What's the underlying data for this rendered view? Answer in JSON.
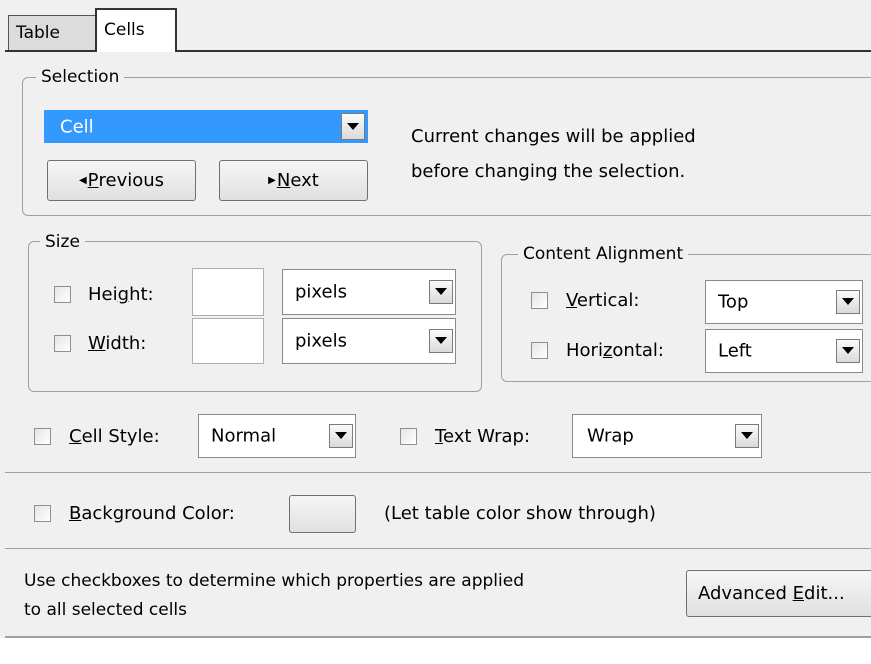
{
  "tabs": [
    {
      "label": "Table",
      "active": false
    },
    {
      "label": "Cells",
      "active": true
    }
  ],
  "selection": {
    "group_label": "Selection",
    "dropdown_value": "Cell",
    "previous_pre": "",
    "previous_u": "P",
    "previous_post": "revious",
    "next_pre": "",
    "next_u": "N",
    "next_post": "ext",
    "info_line1": "Current changes will be applied",
    "info_line2": "before changing the selection."
  },
  "size": {
    "group_label": "Size",
    "height_pre": "Hei",
    "height_u": "g",
    "height_post": "ht:",
    "width_pre": "",
    "width_u": "W",
    "width_post": "idth:",
    "height_value": "",
    "width_value": "",
    "height_unit": "pixels",
    "width_unit": "pixels"
  },
  "alignment": {
    "group_label": "Content Alignment",
    "vertical_pre": "",
    "vertical_u": "V",
    "vertical_post": "ertical:",
    "horizontal_pre": "Hori",
    "horizontal_u": "z",
    "horizontal_post": "ontal:",
    "vertical_value": "Top",
    "horizontal_value": "Left"
  },
  "cell_style": {
    "pre": "",
    "u": "C",
    "post": "ell Style:",
    "value": "Normal"
  },
  "text_wrap": {
    "pre": "",
    "u": "T",
    "post": "ext Wrap:",
    "value": "Wrap"
  },
  "background": {
    "pre": "",
    "u": "B",
    "post": "ackground Color:",
    "note": "(Let table color show through)"
  },
  "footer": {
    "hint_line1": "Use checkboxes to determine which properties are applied",
    "hint_line2": "to all selected cells",
    "advanced_pre": "Advanced ",
    "advanced_u": "E",
    "advanced_post": "dit..."
  },
  "colors": {
    "selection_highlight": "#3399ff",
    "background": "#f0f0f0"
  },
  "icons": {
    "dropdown_arrow": "triangle-down-icon",
    "prev": "triangle-left-icon",
    "next": "triangle-right-icon"
  }
}
